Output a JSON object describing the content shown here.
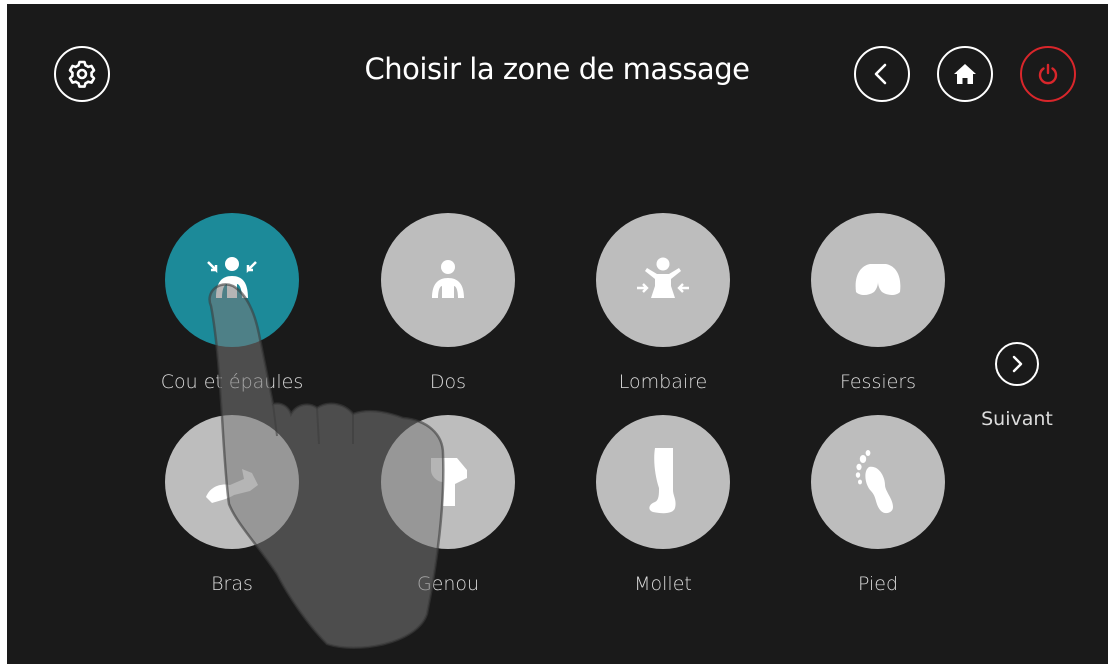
{
  "header": {
    "title": "Choisir la zone de massage",
    "settings_icon": "gear-icon",
    "back_icon": "chevron-left-icon",
    "home_icon": "home-icon",
    "power_icon": "power-icon",
    "power_color": "#d9262b"
  },
  "zones": [
    {
      "label": "Cou et épaules",
      "icon": "neck-shoulders-icon",
      "selected": true
    },
    {
      "label": "Dos",
      "icon": "back-icon",
      "selected": false
    },
    {
      "label": "Lombaire",
      "icon": "lumbar-icon",
      "selected": false
    },
    {
      "label": "Fessiers",
      "icon": "buttocks-icon",
      "selected": false
    },
    {
      "label": "Bras",
      "icon": "arm-icon",
      "selected": false
    },
    {
      "label": "Genou",
      "icon": "knee-icon",
      "selected": false
    },
    {
      "label": "Mollet",
      "icon": "calf-icon",
      "selected": false
    },
    {
      "label": "Pied",
      "icon": "foot-icon",
      "selected": false
    }
  ],
  "next": {
    "label": "Suivant",
    "icon": "chevron-right-icon"
  },
  "colors": {
    "background": "#1a1a1a",
    "selected": "#1c8a99",
    "unselected": "#bdbdbd"
  }
}
